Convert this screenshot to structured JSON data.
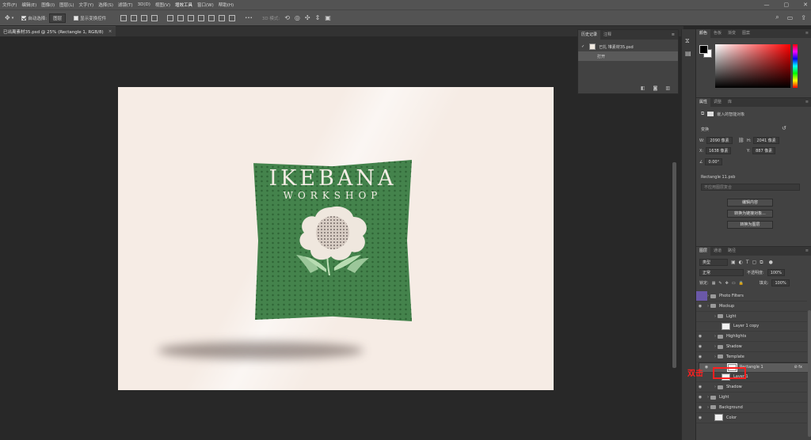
{
  "menubar": {
    "items": [
      "文件(F)",
      "编辑(E)",
      "图像(I)",
      "图层(L)",
      "文字(Y)",
      "选择(S)",
      "滤镜(T)",
      "3D(D)",
      "视图(V)",
      "增效工具",
      "窗口(W)",
      "帮助(H)"
    ],
    "window_controls": [
      "—",
      "▢",
      "✕"
    ]
  },
  "options": {
    "auto_select_label": "自动选择:",
    "auto_select_value": "图层",
    "show_transform_label": "显示变换控件",
    "more": "•••",
    "mode_3d_label": "3D 模式:"
  },
  "document": {
    "tab_title": "已出离素材35.psd @ 25% (Rectangle 1, RGB/8)",
    "tab_close": "×"
  },
  "artwork": {
    "title": "IKEBANA",
    "subtitle": "WORKSHOP"
  },
  "history": {
    "tabs": [
      "历史记录",
      "注释"
    ],
    "doc_row": "已扎 堆素材35.psd",
    "action_row": "打开"
  },
  "color_panel": {
    "tabs": [
      "颜色",
      "色板",
      "渐变",
      "图案"
    ],
    "foreground": "#000000",
    "background": "#ffffff"
  },
  "properties": {
    "tabs": [
      "属性",
      "调整",
      "库"
    ],
    "object_type": "嵌入的智能对象",
    "section_label": "变换",
    "w_label": "W:",
    "w_value": "2090 像素",
    "h_label": "H:",
    "h_value": "2041 像素",
    "x_label": "X:",
    "x_value": "1638 像素",
    "y_label": "Y:",
    "y_value": "887 像素",
    "angle_value": "0.00°",
    "filename": "Rectangle 11.psb",
    "comp_placeholder": "不应用图层复合",
    "buttons": [
      "编辑内容",
      "转换为链接对象...",
      "转换为图层"
    ]
  },
  "layers": {
    "tabs": [
      "图层",
      "通道",
      "路径"
    ],
    "filter_kind": "类型",
    "blend_mode": "正常",
    "opacity_label": "不透明度:",
    "opacity_value": "100%",
    "lock_label": "锁定:",
    "fill_label": "填充:",
    "fill_value": "100%",
    "rows": [
      {
        "name": "Photo Filters",
        "kind": "folder",
        "indent": 0,
        "eye": false
      },
      {
        "name": "Mockup",
        "kind": "folder",
        "indent": 0,
        "eye": true
      },
      {
        "name": "Light",
        "kind": "folder",
        "indent": 1,
        "eye": false
      },
      {
        "name": "Layer 1 copy",
        "kind": "layer",
        "indent": 2,
        "eye": false
      },
      {
        "name": "Highlights",
        "kind": "folder",
        "indent": 1,
        "eye": true
      },
      {
        "name": "Shadow",
        "kind": "folder",
        "indent": 1,
        "eye": true
      },
      {
        "name": "Template",
        "kind": "folder",
        "indent": 1,
        "eye": true
      },
      {
        "name": "Rectangle 1",
        "kind": "smart",
        "indent": 2,
        "eye": true
      },
      {
        "name": "Layer 1",
        "kind": "layer",
        "indent": 2,
        "eye": false
      },
      {
        "name": "Shadow",
        "kind": "folder",
        "indent": 1,
        "eye": true
      },
      {
        "name": "Light",
        "kind": "folder",
        "indent": 0,
        "eye": true
      },
      {
        "name": "Background",
        "kind": "folder",
        "indent": 0,
        "eye": true
      },
      {
        "name": "Color",
        "kind": "layer",
        "indent": 1,
        "eye": true
      }
    ]
  },
  "annotation": {
    "text": "双击",
    "color": "#ff2020"
  }
}
